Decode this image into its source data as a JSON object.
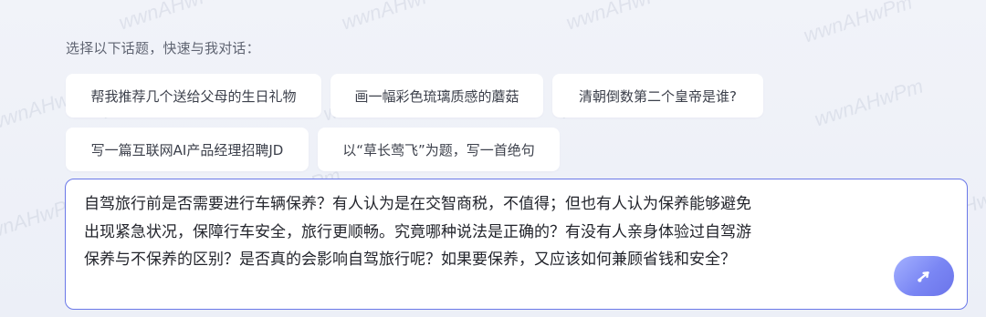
{
  "watermark_text": "wwnAHwPm",
  "prompt_label": "选择以下话题，快速与我对话：",
  "topics": [
    {
      "label": "帮我推荐几个送给父母的生日礼物"
    },
    {
      "label": "画一幅彩色琉璃质感的蘑菇"
    },
    {
      "label": "清朝倒数第二个皇帝是谁?"
    },
    {
      "label": "写一篇互联网AI产品经理招聘JD"
    },
    {
      "label": "以“草长莺飞”为题，写一首绝句"
    }
  ],
  "input": {
    "lines": [
      "自驾旅行前是否需要进行车辆保养？有人认为是在交智商税，不值得；但也有人认为保养能够避免",
      "出现紧急状况，保障行车安全，旅行更顺畅。究竟哪种说法是正确的？有没有人亲身体验过自驾游",
      "保养与不保养的区别？是否真的会影响自驾旅行呢？如果要保养，又应该如何兼顾省钱和安全？"
    ]
  },
  "send_button": {
    "icon": "send-icon",
    "color": "#7a86f4"
  }
}
